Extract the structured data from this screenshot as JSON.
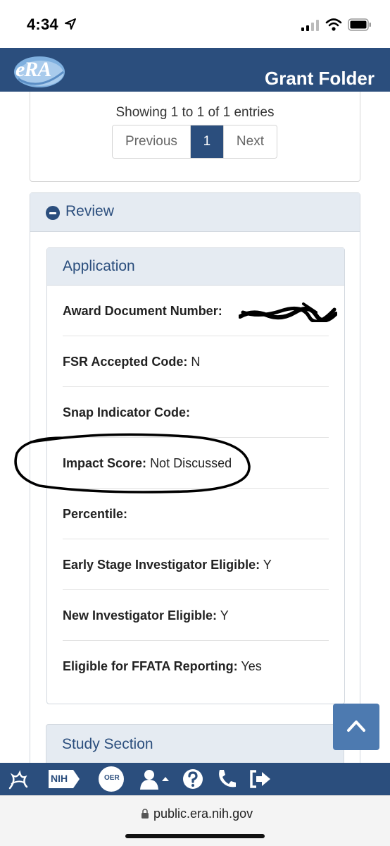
{
  "status_bar": {
    "time": "4:34"
  },
  "header": {
    "logo_text": "eRA",
    "title": "Grant Folder"
  },
  "pagination": {
    "summary": "Showing 1 to 1 of 1 entries",
    "previous_label": "Previous",
    "current_page": "1",
    "next_label": "Next"
  },
  "review": {
    "title": "Review",
    "application": {
      "title": "Application",
      "fields": [
        {
          "label": "Award Document Number:",
          "value": ""
        },
        {
          "label": "FSR Accepted Code:",
          "value": "N"
        },
        {
          "label": "Snap Indicator Code:",
          "value": ""
        },
        {
          "label": "Impact Score:",
          "value": "Not Discussed"
        },
        {
          "label": "Percentile:",
          "value": ""
        },
        {
          "label": "Early Stage Investigator Eligible:",
          "value": "Y"
        },
        {
          "label": "New Investigator Eligible:",
          "value": "Y"
        },
        {
          "label": "Eligible for FFATA Reporting:",
          "value": "Yes"
        }
      ]
    },
    "study_section": {
      "title": "Study Section"
    }
  },
  "bottom_nav": {
    "items": [
      "hhs-icon",
      "nih-icon",
      "oer-icon",
      "user-icon",
      "help-icon",
      "phone-icon",
      "logout-icon"
    ],
    "nih_label": "NIH",
    "oer_label": "OER"
  },
  "browser": {
    "url": "public.era.nih.gov"
  },
  "colors": {
    "brand_blue": "#2b4e7d",
    "panel_header": "#e5ebf2",
    "scroll_button": "#4d7ab0"
  }
}
